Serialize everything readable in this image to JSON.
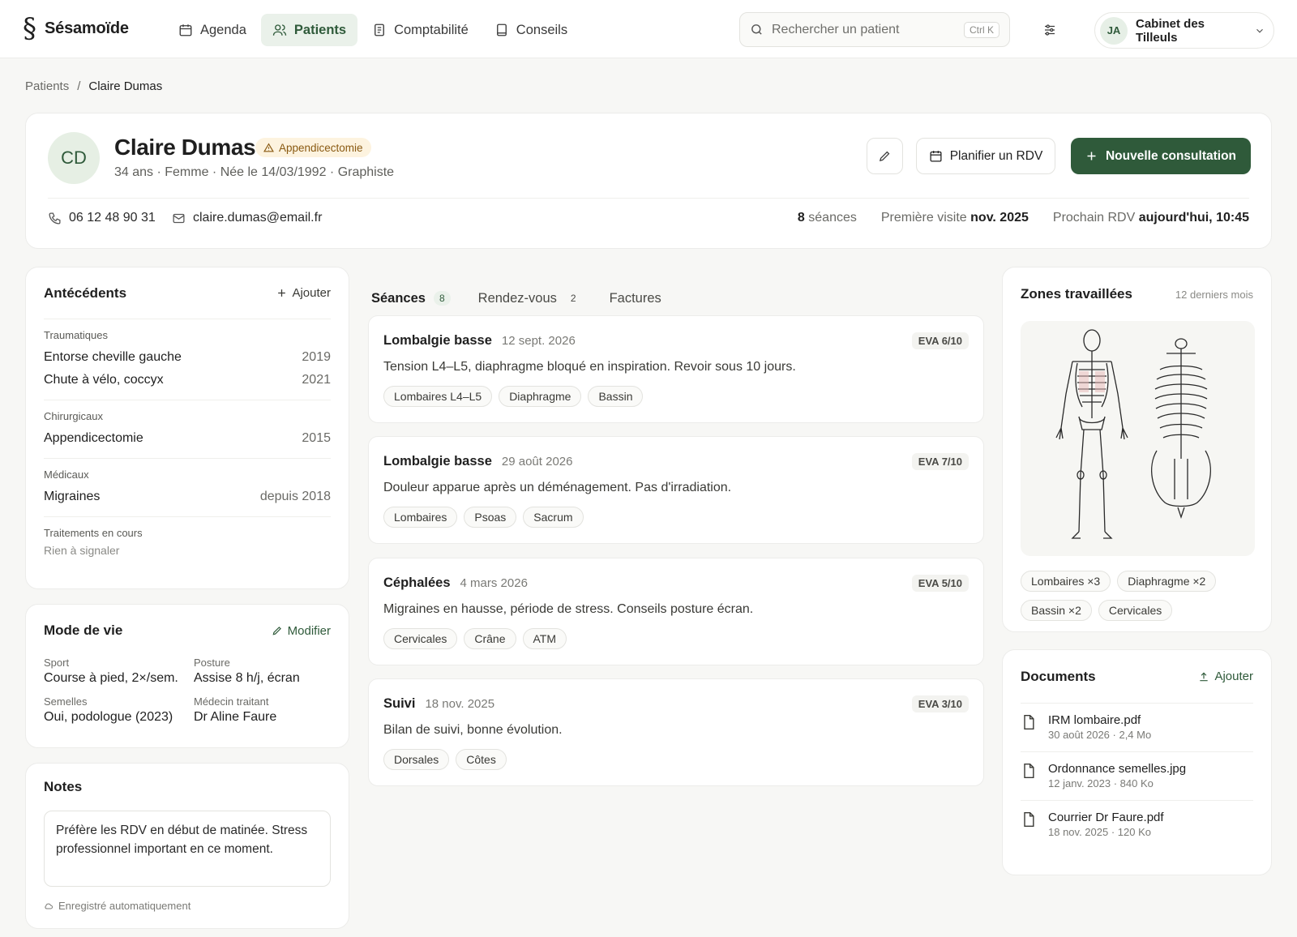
{
  "app": {
    "name": "Sésamoïde"
  },
  "nav": {
    "items": [
      {
        "label": "Agenda"
      },
      {
        "label": "Patients"
      },
      {
        "label": "Comptabilité"
      },
      {
        "label": "Conseils"
      }
    ]
  },
  "search": {
    "placeholder": "Rechercher un patient",
    "shortcut": "Ctrl K"
  },
  "account": {
    "initials": "JA",
    "name": "Cabinet des Tilleuls"
  },
  "breadcrumb": {
    "root": "Patients",
    "separator": "/",
    "current": "Claire Dumas"
  },
  "patient": {
    "initials": "CD",
    "name": "Claire Dumas",
    "alert": "Appendicectomie",
    "meta": "34 ans · Femme · Née le 14/03/1992 · Graphiste",
    "phone": "06 12 48 90 31",
    "email": "claire.dumas@email.fr",
    "sessions_count": "8",
    "sessions_label": "séances",
    "first_visit_label": "Première visite",
    "first_visit": "nov. 2025",
    "next_rdv_label": "Prochain RDV",
    "next_rdv": "aujourd'hui, 10:45"
  },
  "actions": {
    "plan": "Planifier un RDV",
    "new": "Nouvelle consultation"
  },
  "antecedents": {
    "title": "Antécédents",
    "add": "Ajouter",
    "groups": [
      {
        "category": "Traumatiques",
        "items": [
          {
            "label": "Entorse cheville gauche",
            "year": "2019"
          },
          {
            "label": "Chute à vélo, coccyx",
            "year": "2021"
          }
        ]
      },
      {
        "category": "Chirurgicaux",
        "items": [
          {
            "label": "Appendicectomie",
            "year": "2015"
          }
        ]
      },
      {
        "category": "Médicaux",
        "items": [
          {
            "label": "Migraines",
            "year": "depuis 2018"
          }
        ]
      },
      {
        "category": "Traitements en cours",
        "empty": "Rien à signaler"
      }
    ]
  },
  "lifestyle": {
    "title": "Mode de vie",
    "edit": "Modifier",
    "fields": [
      {
        "label": "Sport",
        "value": "Course à pied, 2×/sem."
      },
      {
        "label": "Posture",
        "value": "Assise 8 h/j, écran"
      },
      {
        "label": "Semelles",
        "value": "Oui, podologue (2023)"
      },
      {
        "label": "Médecin traitant",
        "value": "Dr Aline Faure"
      }
    ]
  },
  "notes": {
    "title": "Notes",
    "text": "Préfère les RDV en début de matinée. Stress professionnel important en ce moment.",
    "autosave": "Enregistré automatiquement"
  },
  "tabs": [
    {
      "label": "Séances",
      "count": "8"
    },
    {
      "label": "Rendez-vous",
      "count": "2"
    },
    {
      "label": "Factures",
      "count": ""
    }
  ],
  "sessions": [
    {
      "title": "Lombalgie basse",
      "date": "12 sept. 2026",
      "eva": "EVA 6/10",
      "text": "Tension L4–L5, diaphragme bloqué en inspiration. Revoir sous 10 jours.",
      "tags": [
        "Lombaires L4–L5",
        "Diaphragme",
        "Bassin"
      ]
    },
    {
      "title": "Lombalgie basse",
      "date": "29 août 2026",
      "eva": "EVA 7/10",
      "text": "Douleur apparue après un déménagement. Pas d'irradiation.",
      "tags": [
        "Lombaires",
        "Psoas",
        "Sacrum"
      ]
    },
    {
      "title": "Céphalées",
      "date": "4 mars 2026",
      "eva": "EVA 5/10",
      "text": "Migraines en hausse, période de stress. Conseils posture écran.",
      "tags": [
        "Cervicales",
        "Crâne",
        "ATM"
      ]
    },
    {
      "title": "Suivi",
      "date": "18 nov. 2025",
      "eva": "EVA 3/10",
      "text": "Bilan de suivi, bonne évolution.",
      "tags": [
        "Dorsales",
        "Côtes"
      ]
    }
  ],
  "zones": {
    "title": "Zones travaillées",
    "range": "12 derniers mois",
    "tags": [
      "Lombaires ×3",
      "Diaphragme ×2",
      "Bassin ×2",
      "Cervicales"
    ]
  },
  "documents": {
    "title": "Documents",
    "add": "Ajouter",
    "items": [
      {
        "name": "IRM lombaire.pdf",
        "meta": "30 août 2026 · 2,4 Mo"
      },
      {
        "name": "Ordonnance semelles.jpg",
        "meta": "12 janv. 2023 · 840 Ko"
      },
      {
        "name": "Courrier Dr Faure.pdf",
        "meta": "18 nov. 2025 · 120 Ko"
      }
    ]
  },
  "colors": {
    "accent": "#2f5a3a",
    "accent_soft": "#eaf1ea",
    "alert_bg": "#fdf3df",
    "alert_text": "#8a5a12"
  }
}
